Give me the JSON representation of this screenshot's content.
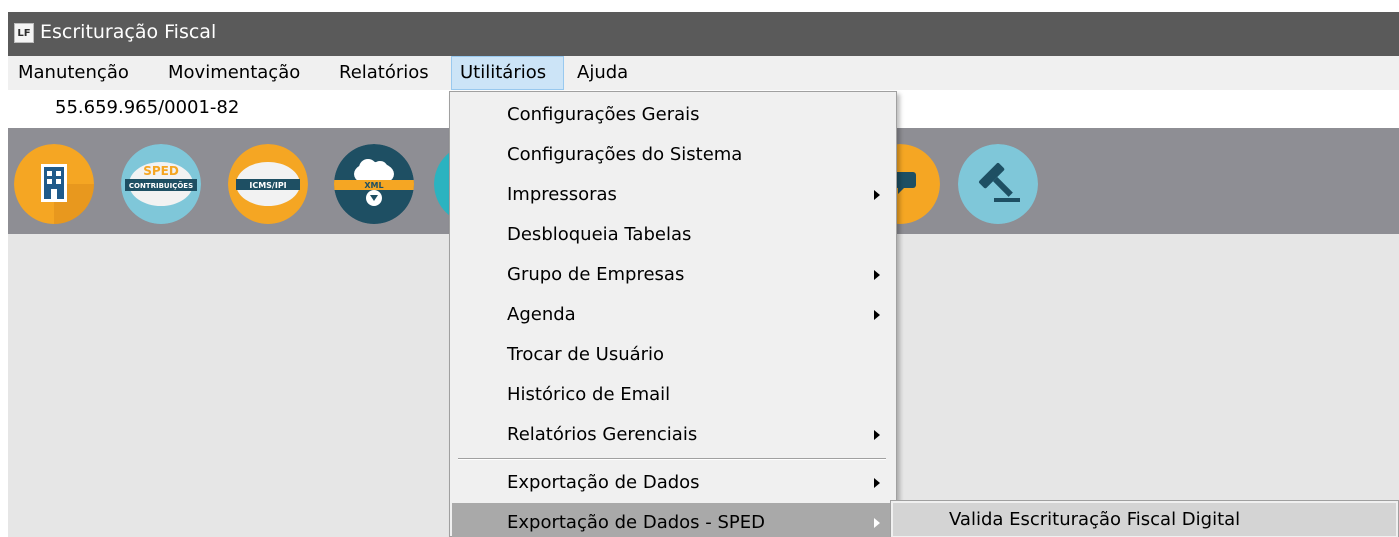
{
  "window": {
    "app_icon_text": "LF",
    "title": "Escrituração Fiscal"
  },
  "menubar": {
    "items": [
      "Manutenção",
      "Movimentação",
      "Relatórios",
      "Utilitários",
      "Ajuda"
    ],
    "active": "Utilitários"
  },
  "company": {
    "cnpj": "55.659.965/0001-82"
  },
  "toolbar": {
    "icons": [
      {
        "name": "building-icon",
        "color": "#f5a623"
      },
      {
        "name": "sped-contribuicoes-icon",
        "label_top": "SPED",
        "label_band": "CONTRIBUIÇÕES",
        "color": "#7fc7d9"
      },
      {
        "name": "icms-ipi-icon",
        "label_band": "ICMS/IPI",
        "color": "#f5a623"
      },
      {
        "name": "xml-cloud-download-icon",
        "label_band": "XML",
        "color": "#1e4f63"
      },
      {
        "name": "partial-teal-icon",
        "color": "#2bb3c0"
      },
      {
        "name": "chat-icon",
        "color": "#f5a623"
      },
      {
        "name": "gavel-icon",
        "color": "#7fc7d9"
      }
    ]
  },
  "dropdown": {
    "items": [
      {
        "label": "Configurações Gerais",
        "submenu": false
      },
      {
        "label": "Configurações do Sistema",
        "submenu": false
      },
      {
        "label": "Impressoras",
        "submenu": true
      },
      {
        "label": "Desbloqueia Tabelas",
        "submenu": false
      },
      {
        "label": "Grupo de Empresas",
        "submenu": true
      },
      {
        "label": "Agenda",
        "submenu": true
      },
      {
        "label": "Trocar de Usuário",
        "submenu": false
      },
      {
        "label": "Histórico de Email",
        "submenu": false
      },
      {
        "label": "Relatórios Gerenciais",
        "submenu": true
      },
      {
        "label": "Exportação de Dados",
        "submenu": true
      },
      {
        "label": "Exportação de Dados - SPED",
        "submenu": true,
        "highlighted": true
      }
    ]
  },
  "submenu": {
    "items": [
      {
        "label": "Valida Escrituração Fiscal Digital"
      }
    ]
  }
}
